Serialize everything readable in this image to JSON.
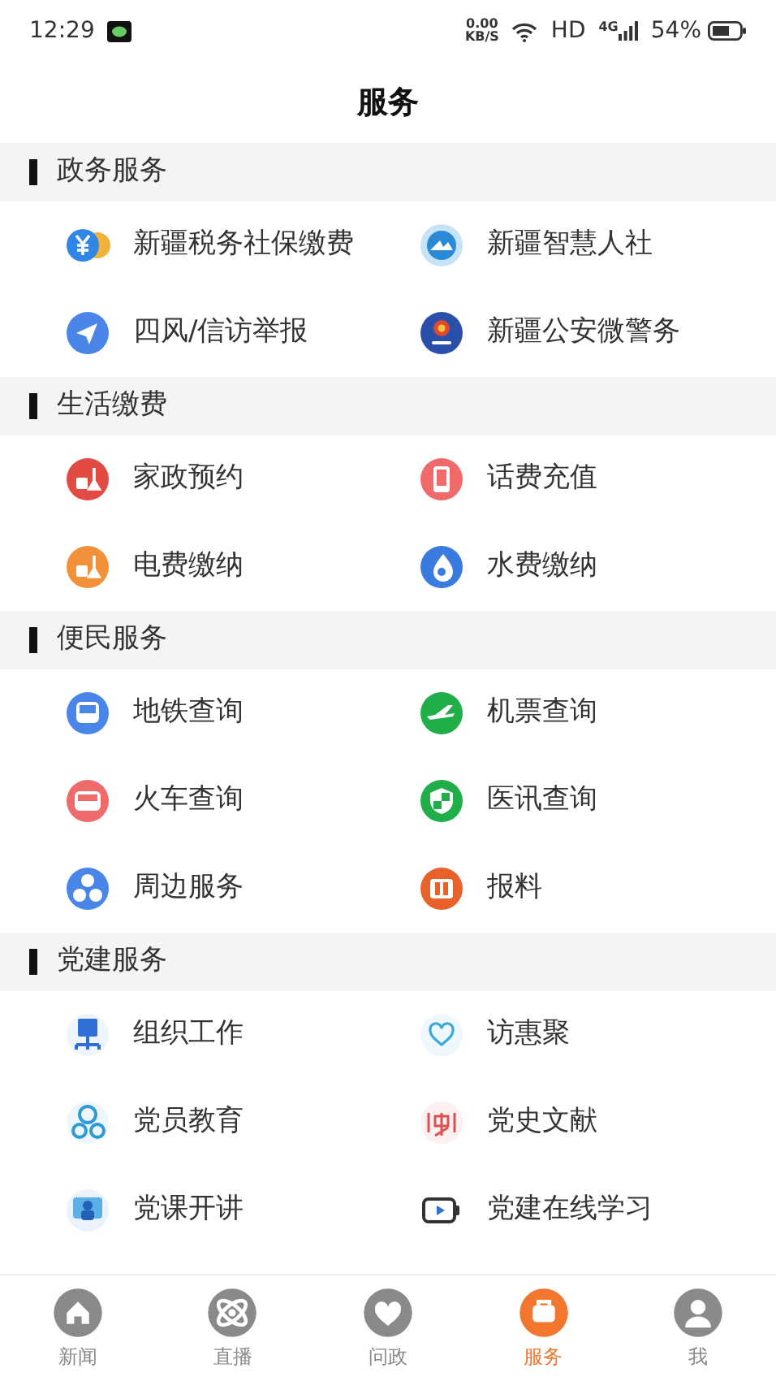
{
  "status_bar": {
    "time": "12:29",
    "speed_value": "0.00",
    "speed_unit": "KB/S",
    "hd": "HD",
    "network": "4G",
    "battery": "54%"
  },
  "title": "服务",
  "sections": [
    {
      "title": "政务服务",
      "items": [
        {
          "label": "新疆税务社保缴费"
        },
        {
          "label": "新疆智慧人社"
        },
        {
          "label": "四风/信访举报"
        },
        {
          "label": "新疆公安微警务"
        }
      ]
    },
    {
      "title": "生活缴费",
      "items": [
        {
          "label": "家政预约"
        },
        {
          "label": "话费充值"
        },
        {
          "label": "电费缴纳"
        },
        {
          "label": "水费缴纳"
        }
      ]
    },
    {
      "title": "便民服务",
      "items": [
        {
          "label": "地铁查询"
        },
        {
          "label": "机票查询"
        },
        {
          "label": "火车查询"
        },
        {
          "label": "医讯查询"
        },
        {
          "label": "周边服务"
        },
        {
          "label": "报料"
        }
      ]
    },
    {
      "title": "党建服务",
      "items": [
        {
          "label": "组织工作"
        },
        {
          "label": "访惠聚"
        },
        {
          "label": "党员教育"
        },
        {
          "label": "党史文献"
        },
        {
          "label": "党课开讲"
        },
        {
          "label": "党建在线学习"
        }
      ]
    }
  ],
  "tabs": [
    {
      "label": "新闻",
      "selected": false
    },
    {
      "label": "直播",
      "selected": false
    },
    {
      "label": "问政",
      "selected": false
    },
    {
      "label": "服务",
      "selected": true
    },
    {
      "label": "我",
      "selected": false
    }
  ]
}
